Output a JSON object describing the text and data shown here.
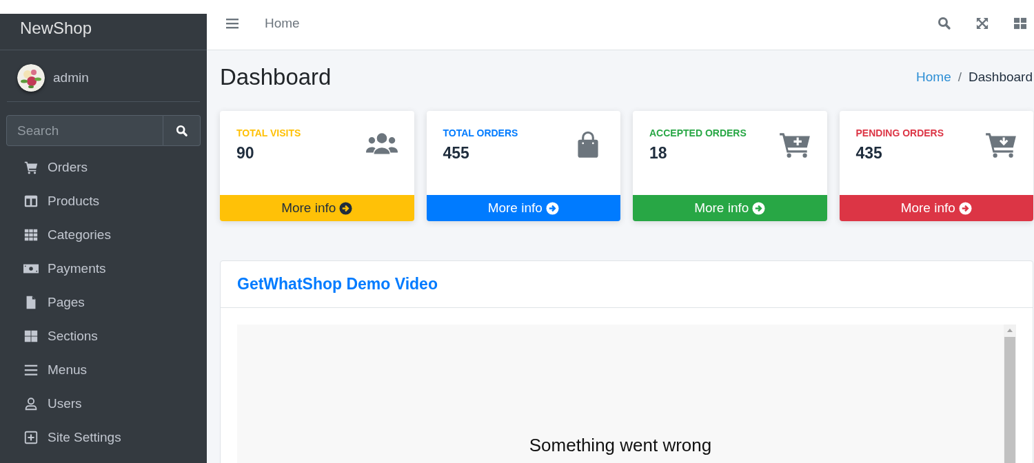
{
  "sidebar": {
    "brand": "NewShop",
    "user": {
      "name": "admin"
    },
    "search": {
      "placeholder": "Search"
    },
    "items": [
      {
        "label": "Orders",
        "kind": "cart"
      },
      {
        "label": "Products",
        "kind": "columns"
      },
      {
        "label": "Categories",
        "kind": "grid"
      },
      {
        "label": "Payments",
        "kind": "money"
      },
      {
        "label": "Pages",
        "kind": "file"
      },
      {
        "label": "Sections",
        "kind": "squares"
      },
      {
        "label": "Menus",
        "kind": "bars"
      },
      {
        "label": "Users",
        "kind": "user"
      },
      {
        "label": "Site Settings",
        "kind": "plus"
      }
    ]
  },
  "topbar": {
    "link": "Home"
  },
  "page": {
    "title": "Dashboard",
    "separator": "/",
    "breadcrumb": [
      {
        "label": "Home",
        "selected": false
      },
      {
        "label": "Dashboard",
        "selected": true
      }
    ]
  },
  "stats": [
    {
      "label": "TOTAL VISITS",
      "value": "90",
      "kind": "users",
      "color": "#ffc107",
      "footer": "More info"
    },
    {
      "label": "TOTAL ORDERS",
      "value": "455",
      "kind": "bag",
      "color": "#007bff",
      "footer": "More info"
    },
    {
      "label": "ACCEPTED ORDERS",
      "value": "18",
      "kind": "cartplus",
      "color": "#28a745",
      "footer": "More info"
    },
    {
      "label": "PENDING ORDERS",
      "value": "435",
      "kind": "cartdown",
      "color": "#dc3545",
      "footer": "More info"
    }
  ],
  "video_card": {
    "title": "GetWhatShop Demo Video",
    "message": "Something went wrong"
  }
}
